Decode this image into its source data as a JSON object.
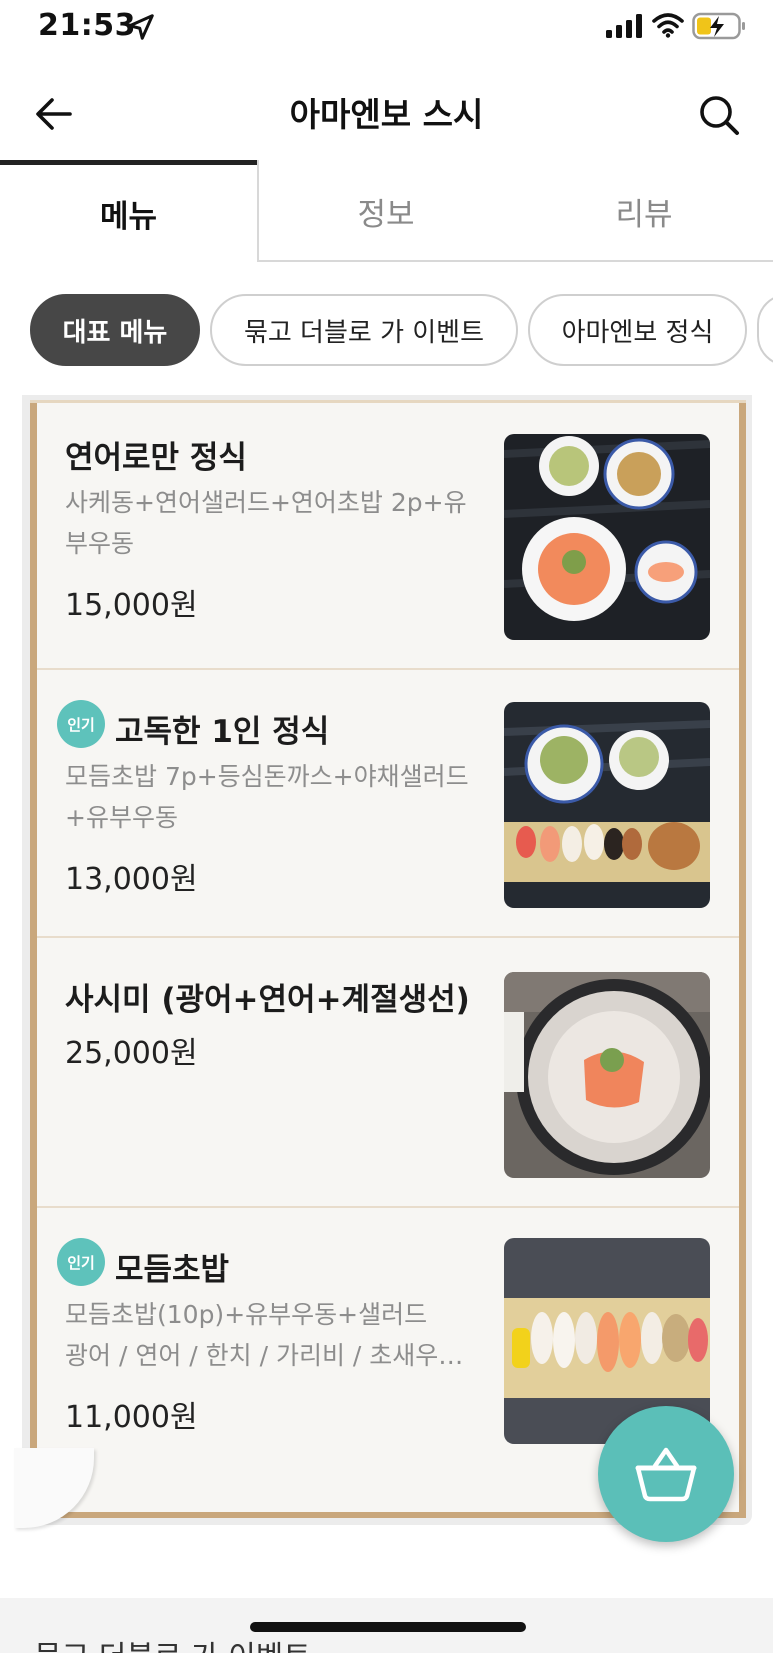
{
  "status_bar": {
    "time": "21:53"
  },
  "header": {
    "title": "아마엔보 스시"
  },
  "tabs": [
    {
      "label": "메뉴"
    },
    {
      "label": "정보"
    },
    {
      "label": "리뷰"
    }
  ],
  "chips": [
    {
      "label": "대표 메뉴"
    },
    {
      "label": "묶고 더블로 가 이벤트"
    },
    {
      "label": "아마엔보 정식"
    }
  ],
  "menu_items": [
    {
      "name": "연어로만 정식",
      "badge": "",
      "desc_lines": [
        "사케동+연어샐러드+연어초밥 2p+유",
        "부우동"
      ],
      "price": "15,000원"
    },
    {
      "name": "고독한 1인 정식",
      "badge": "인기",
      "desc_lines": [
        "모듬초밥 7p+등심돈까스+야채샐러드",
        "+유부우동"
      ],
      "price": "13,000원"
    },
    {
      "name": "사시미 (광어+연어+계절생선)",
      "badge": "",
      "desc_lines": [],
      "price": "25,000원"
    },
    {
      "name": "모듬초밥",
      "badge": "인기",
      "desc_lines": [
        "모듬초밥(10p)+유부우동+샐러드",
        "광어 / 연어 / 한치 / 가리비 / 초새우…"
      ],
      "price": "11,000원"
    }
  ],
  "bottom_section": {
    "title": "묶고 더블로 가 이벤트"
  },
  "colors": {
    "accent": "#5ec2bb",
    "board_frame": "#c9a77c",
    "chip_active": "#474747"
  },
  "icons": {
    "back": "arrow-left-icon",
    "search": "search-icon",
    "cart": "basket-icon"
  }
}
